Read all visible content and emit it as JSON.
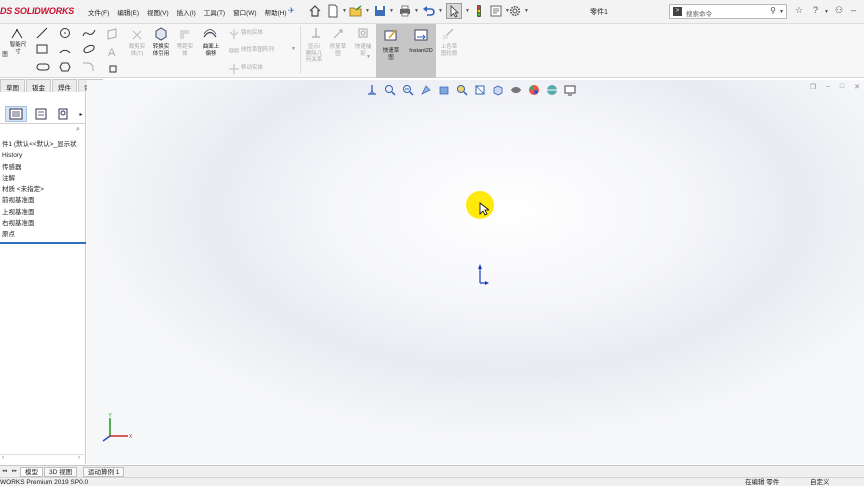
{
  "app": {
    "logo_prefix": "DS",
    "logo": "SOLIDWORKS",
    "document_title": "零件1"
  },
  "menu": [
    "文件(F)",
    "编辑(E)",
    "视图(V)",
    "插入(I)",
    "工具(T)",
    "窗口(W)",
    "帮助(H)"
  ],
  "search": {
    "placeholder": "搜索命令"
  },
  "ribbon": {
    "smart_dimension": "智能尺\n寸",
    "convert_entities": "转换实\n体引用",
    "offset_on_surface": "曲面上\n偏移",
    "trim_entities": "裁剪实\n体(T)",
    "offset_entities": "等距实\n体",
    "mirror_entities": "镜向实体",
    "linear_pattern": "线性草图阵列",
    "move_entities": "移动实体",
    "display_delete_relations": "显示/\n删除几\n何关系",
    "repair_sketch": "修复草\n图",
    "quick_snaps": "快速捕\n捉",
    "rapid_sketch": "快速草\n图",
    "instant2d": "Instant2D",
    "shaded_sketch_contours": "上色草\n图轮廓"
  },
  "cm_tabs": [
    "草图",
    "钣金",
    "焊件",
    "评估"
  ],
  "tree": {
    "root": "件1  (默认<<默认>_显示状",
    "items": [
      "History",
      "传感器",
      "注解",
      "材质 <未指定>",
      "前视基准面",
      "上视基准面",
      "右视基准面",
      "原点"
    ]
  },
  "model_tabs": [
    "模型",
    "3D 视图",
    "运动算例 1"
  ],
  "status": {
    "version": "WORKS Premium 2019 SP0.0",
    "editing": "在编辑 零件",
    "units": "自定义"
  },
  "colors": {
    "brand_red": "#c8102e",
    "cursor_halo": "#ffe800",
    "quick_sketch_bg": "#c6c6c6",
    "selected_tab_blue": "#2f6fbf"
  }
}
